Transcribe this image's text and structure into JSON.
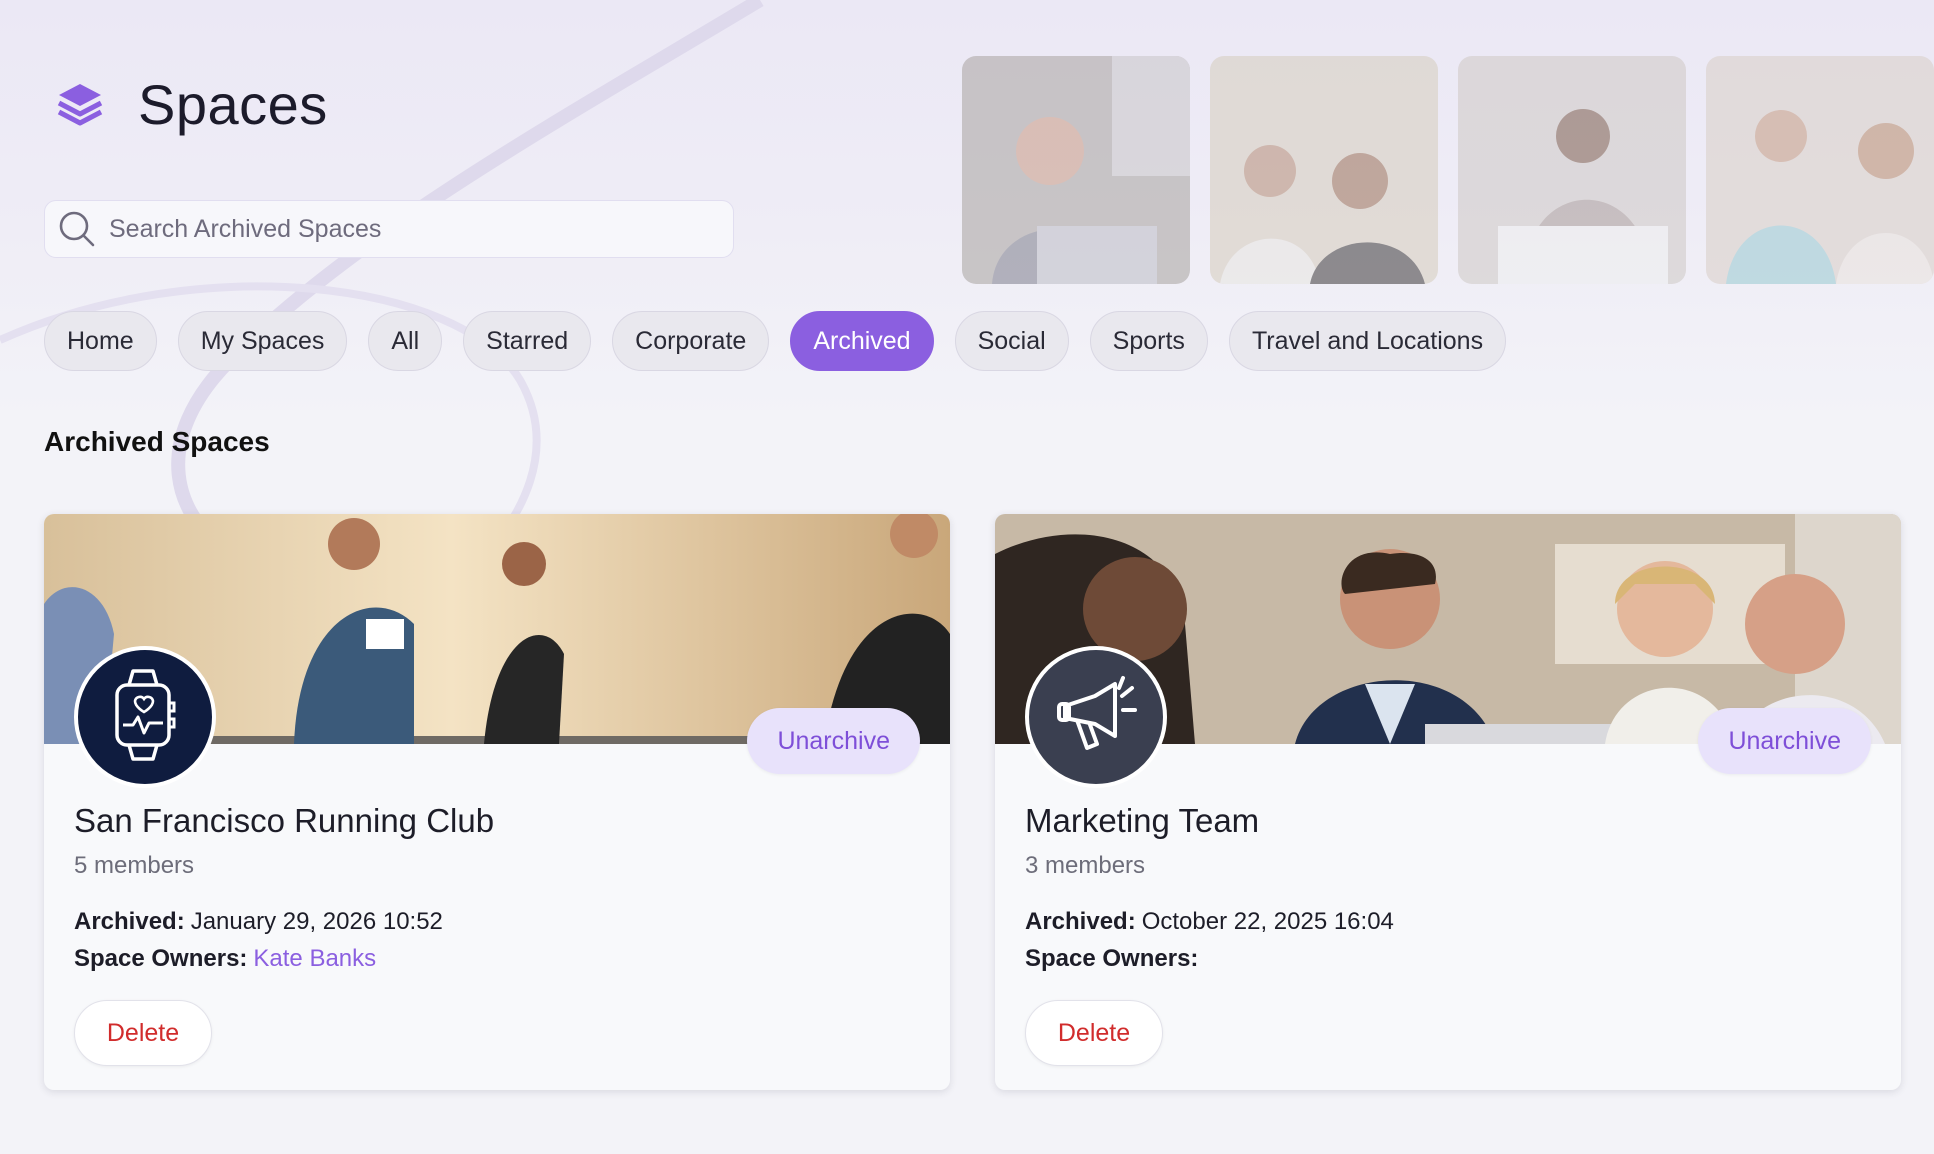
{
  "header": {
    "title": "Spaces",
    "logo_icon": "layers-icon"
  },
  "search": {
    "placeholder": "Search Archived Spaces",
    "value": ""
  },
  "tabs": [
    {
      "label": "Home",
      "active": false
    },
    {
      "label": "My Spaces",
      "active": false
    },
    {
      "label": "All",
      "active": false
    },
    {
      "label": "Starred",
      "active": false
    },
    {
      "label": "Corporate",
      "active": false
    },
    {
      "label": "Archived",
      "active": true
    },
    {
      "label": "Social",
      "active": false
    },
    {
      "label": "Sports",
      "active": false
    },
    {
      "label": "Travel and Locations",
      "active": false
    }
  ],
  "section": {
    "title": "Archived Spaces"
  },
  "cards": [
    {
      "name": "San Francisco Running Club",
      "members": "5 members",
      "archived_label": "Archived:",
      "archived_value": "January 29, 2026 10:52",
      "owners_label": "Space Owners:",
      "owners_value": "Kate Banks",
      "unarchive_label": "Unarchive",
      "delete_label": "Delete",
      "icon": "smartwatch-heart-icon",
      "banner": "running-banner-image"
    },
    {
      "name": "Marketing Team",
      "members": "3 members",
      "archived_label": "Archived:",
      "archived_value": "October 22, 2025 16:04",
      "owners_label": "Space Owners:",
      "owners_value": "",
      "unarchive_label": "Unarchive",
      "delete_label": "Delete",
      "icon": "megaphone-icon",
      "banner": "meeting-banner-image"
    }
  ],
  "colors": {
    "accent": "#8b5fe0",
    "delete": "#d12c2c",
    "background": "#f3f3f8"
  }
}
